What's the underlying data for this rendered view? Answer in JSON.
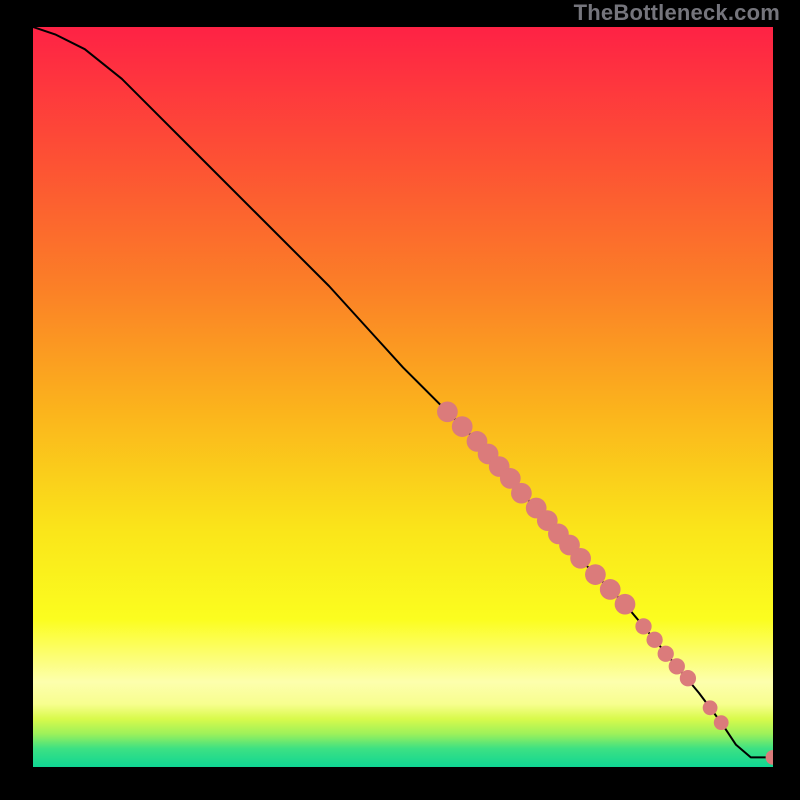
{
  "attribution": "TheBottleneck.com",
  "chart_data": {
    "type": "line",
    "title": "",
    "xlabel": "",
    "ylabel": "",
    "xlim": [
      0,
      100
    ],
    "ylim": [
      0,
      100
    ],
    "curve": {
      "name": "bottleneck-curve",
      "x": [
        0,
        3,
        7,
        12,
        20,
        30,
        40,
        50,
        56,
        60,
        65,
        70,
        75,
        80,
        85,
        90,
        93,
        95,
        97,
        100
      ],
      "y": [
        100,
        99,
        97,
        93,
        85,
        75,
        65,
        54,
        48,
        44,
        38,
        33,
        27,
        22,
        16,
        10,
        6,
        3,
        1.3,
        1.3
      ]
    },
    "markers": {
      "name": "highlight-points",
      "color": "#db7b7b",
      "points": [
        {
          "x": 56,
          "y": 48,
          "r": 1.4
        },
        {
          "x": 58,
          "y": 46,
          "r": 1.4
        },
        {
          "x": 60,
          "y": 44,
          "r": 1.4
        },
        {
          "x": 61.5,
          "y": 42.3,
          "r": 1.4
        },
        {
          "x": 63,
          "y": 40.6,
          "r": 1.4
        },
        {
          "x": 64.5,
          "y": 39,
          "r": 1.4
        },
        {
          "x": 66,
          "y": 37,
          "r": 1.4
        },
        {
          "x": 68,
          "y": 35,
          "r": 1.4
        },
        {
          "x": 69.5,
          "y": 33.3,
          "r": 1.4
        },
        {
          "x": 71,
          "y": 31.5,
          "r": 1.4
        },
        {
          "x": 72.5,
          "y": 30,
          "r": 1.4
        },
        {
          "x": 74,
          "y": 28.2,
          "r": 1.4
        },
        {
          "x": 76,
          "y": 26,
          "r": 1.4
        },
        {
          "x": 78,
          "y": 24,
          "r": 1.4
        },
        {
          "x": 80,
          "y": 22,
          "r": 1.4
        },
        {
          "x": 82.5,
          "y": 19,
          "r": 1.1
        },
        {
          "x": 84,
          "y": 17.2,
          "r": 1.1
        },
        {
          "x": 85.5,
          "y": 15.3,
          "r": 1.1
        },
        {
          "x": 87,
          "y": 13.6,
          "r": 1.1
        },
        {
          "x": 88.5,
          "y": 12,
          "r": 1.1
        },
        {
          "x": 91.5,
          "y": 8,
          "r": 1.0
        },
        {
          "x": 93,
          "y": 6,
          "r": 1.0
        },
        {
          "x": 100,
          "y": 1.3,
          "r": 1.0
        }
      ]
    },
    "background_gradient": {
      "type": "vertical",
      "stops": [
        {
          "offset": 0.0,
          "color": "#fe2245"
        },
        {
          "offset": 0.18,
          "color": "#fd5134"
        },
        {
          "offset": 0.35,
          "color": "#fb7f27"
        },
        {
          "offset": 0.52,
          "color": "#fbb41c"
        },
        {
          "offset": 0.68,
          "color": "#fae51a"
        },
        {
          "offset": 0.8,
          "color": "#fbfd1f"
        },
        {
          "offset": 0.885,
          "color": "#fdffad"
        },
        {
          "offset": 0.915,
          "color": "#f7fe8f"
        },
        {
          "offset": 0.935,
          "color": "#d8fa4b"
        },
        {
          "offset": 0.955,
          "color": "#9ef15a"
        },
        {
          "offset": 0.975,
          "color": "#3de183"
        },
        {
          "offset": 1.0,
          "color": "#0fd693"
        }
      ]
    }
  }
}
